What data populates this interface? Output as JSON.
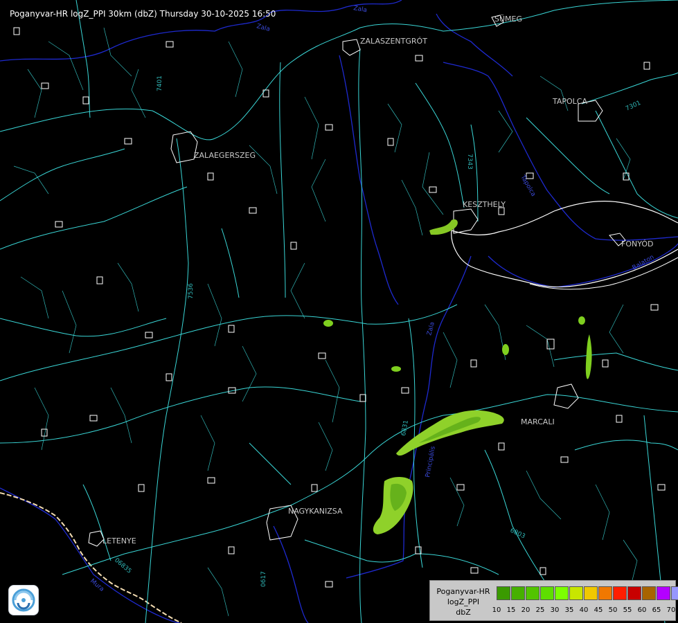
{
  "title": "Poganyvar-HR logZ_PPI 30km (dbZ) Thursday 30-10-2025 16:50",
  "towns": [
    "SÜMEG",
    "ZALASZENTGRÓT",
    "TAPOLCA",
    "ZALAEGERSZEG",
    "KESZTHELY",
    "FONYÓD",
    "MARCALI",
    "NAGYKANIZSA",
    "LETENYE"
  ],
  "road_labels": [
    "7401",
    "7343",
    "7301",
    "7536",
    "6831",
    "6803",
    "06835",
    "0617"
  ],
  "river_labels": [
    "Zala",
    "Zala",
    "Tapolca",
    "Balaton",
    "Principális",
    "Zala",
    "Mura"
  ],
  "legend": {
    "line1": "Poganyvar-HR",
    "line2": "logZ_PPI",
    "line3": "dbZ",
    "colors": [
      "#3a9a00",
      "#46b000",
      "#52c400",
      "#5ede00",
      "#7cff00",
      "#c8e600",
      "#f0c800",
      "#f07800",
      "#ff1e00",
      "#c80000",
      "#a86400",
      "#b400ff",
      "#9696ff"
    ],
    "ticks": [
      "10",
      "15",
      "20",
      "25",
      "30",
      "35",
      "40",
      "45",
      "50",
      "55",
      "60",
      "65",
      "70"
    ]
  },
  "colors": {
    "background": "#000000",
    "road": "#3ad7d7",
    "river": "#1e2ad0",
    "border": "#f5deb3",
    "settlement": "#ffffff",
    "echo_light": "#8fd12a",
    "echo_dark": "#66b21b"
  },
  "icons": {
    "logo": "weather-service-logo-icon"
  }
}
